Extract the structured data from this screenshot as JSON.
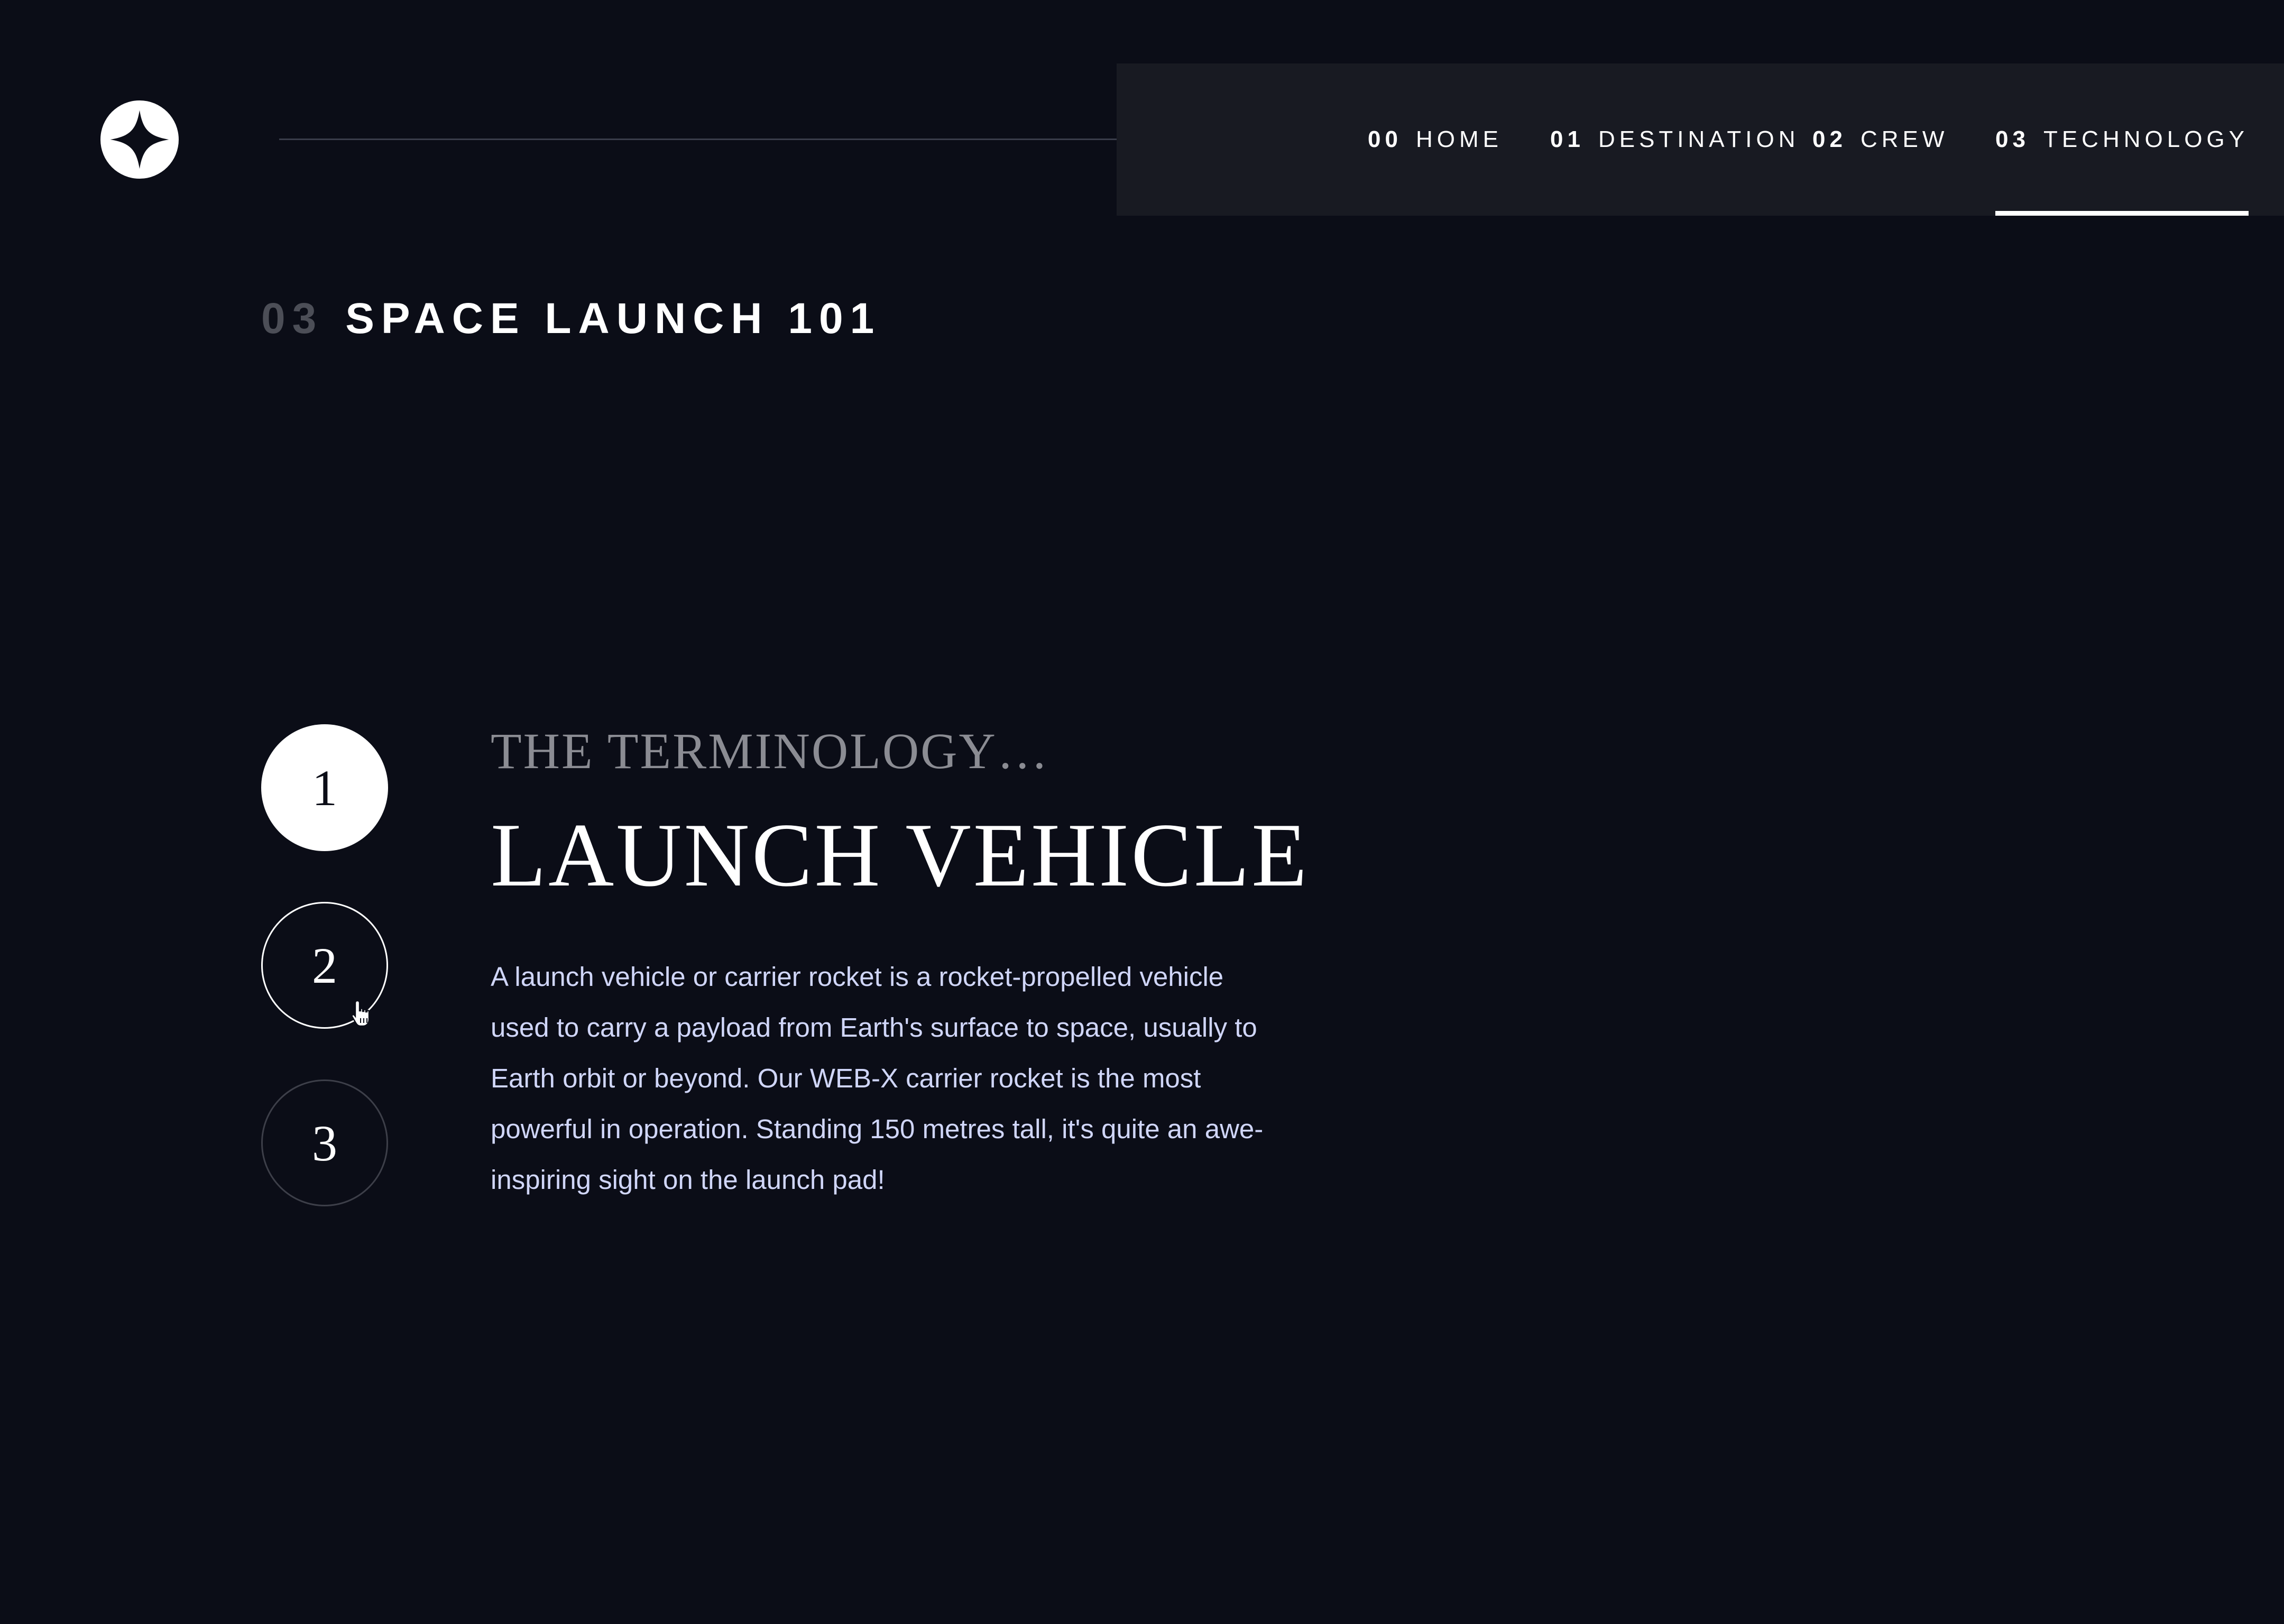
{
  "header": {
    "logo_icon": "star-logo-icon"
  },
  "nav": {
    "items": [
      {
        "num": "00",
        "label": "HOME"
      },
      {
        "num": "01",
        "label": "DESTINATION"
      },
      {
        "num": "02",
        "label": "CREW"
      },
      {
        "num": "03",
        "label": "TECHNOLOGY"
      }
    ],
    "active": "TECHNOLOGY"
  },
  "page": {
    "num": "03",
    "title": "SPACE LAUNCH 101"
  },
  "steps": {
    "items": [
      "1",
      "2",
      "3"
    ],
    "active": "1"
  },
  "content": {
    "subtitle": "THE TERMINOLOGY…",
    "heading": "LAUNCH VEHICLE",
    "body": "A launch vehicle or carrier rocket is a rocket-propelled vehicle used to carry a payload from Earth's surface to space, usually to Earth orbit or beyond. Our WEB-X carrier rocket is the most powerful in operation. Standing 150 metres tall, it's quite an awe-inspiring sight on the launch pad!"
  },
  "colors": {
    "background": "#0b0d17",
    "nav_background": "#181a22",
    "body_text": "#d0d6f9",
    "muted": "#8b8c93"
  }
}
